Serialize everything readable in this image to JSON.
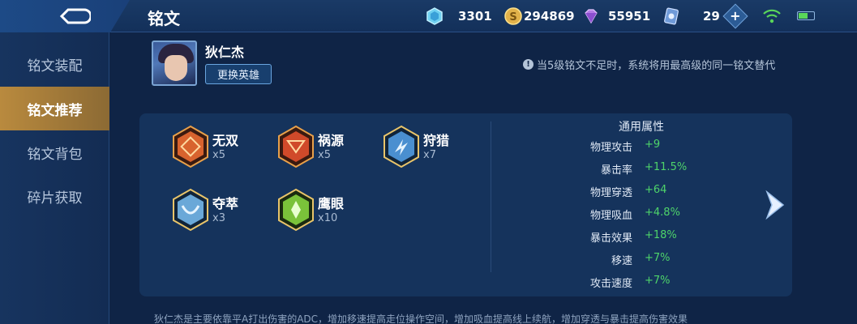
{
  "header": {
    "title": "铭文",
    "resources": {
      "crystal": "3301",
      "gold_coin": "294869",
      "diamond": "55951",
      "voucher": "29"
    }
  },
  "sidebar": {
    "items": [
      {
        "label": "铭文装配"
      },
      {
        "label": "铭文推荐"
      },
      {
        "label": "铭文背包"
      },
      {
        "label": "碎片获取"
      }
    ],
    "active_index": 1
  },
  "hero": {
    "name": "狄仁杰",
    "change_button": "更换英雄"
  },
  "notice": "当5级铭文不足时，系统将用最高级的同一铭文替代",
  "runes": [
    {
      "name": "无双",
      "count": "x5",
      "color": "#d8632e"
    },
    {
      "name": "祸源",
      "count": "x5",
      "color": "#d8632e"
    },
    {
      "name": "狩猎",
      "count": "x7",
      "color": "#4a8fd0"
    },
    {
      "name": "夺萃",
      "count": "x3",
      "color": "#4a8fd0"
    },
    {
      "name": "鹰眼",
      "count": "x10",
      "color": "#7ac23a"
    }
  ],
  "attributes": {
    "title": "通用属性",
    "rows": [
      {
        "name": "物理攻击",
        "value": "+9"
      },
      {
        "name": "暴击率",
        "value": "+11.5%"
      },
      {
        "name": "物理穿透",
        "value": "+64"
      },
      {
        "name": "物理吸血",
        "value": "+4.8%"
      },
      {
        "name": "暴击效果",
        "value": "+18%"
      },
      {
        "name": "移速",
        "value": "+7%"
      },
      {
        "name": "攻击速度",
        "value": "+7%"
      }
    ]
  },
  "footer": "狄仁杰是主要依靠平A打出伤害的ADC，增加移速提高走位操作空间，增加吸血提高线上续航，增加穿透与暴击提高伤害效果"
}
